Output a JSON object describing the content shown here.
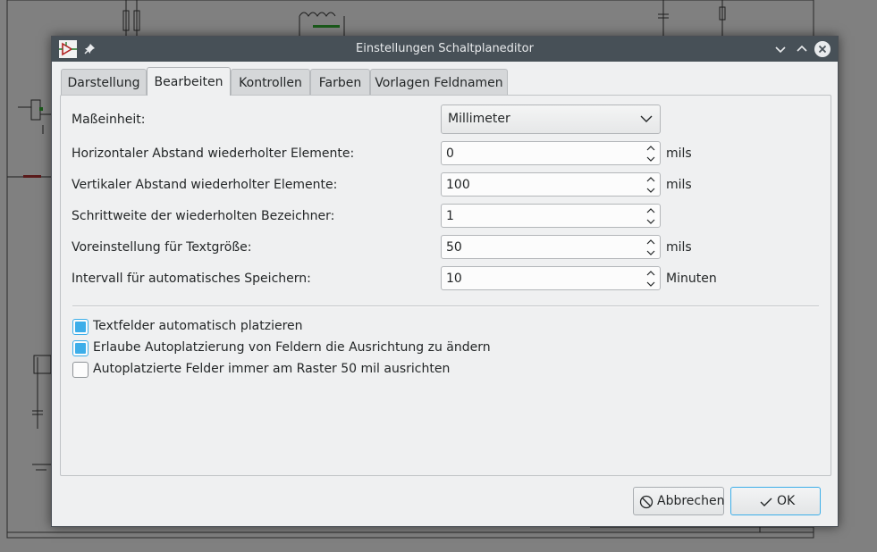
{
  "window": {
    "title": "Einstellungen Schaltplaneditor"
  },
  "tabs": [
    {
      "label": "Darstellung",
      "active": false
    },
    {
      "label": "Bearbeiten",
      "active": true
    },
    {
      "label": "Kontrollen",
      "active": false
    },
    {
      "label": "Farben",
      "active": false
    },
    {
      "label": "Vorlagen Feldnamen",
      "active": false
    }
  ],
  "form": {
    "unit": {
      "label": "Maßeinheit:",
      "value": "Millimeter"
    },
    "h_spacing": {
      "label": "Horizontaler Abstand wiederholter Elemente:",
      "value": "0",
      "unit": "mils"
    },
    "v_spacing": {
      "label": "Vertikaler Abstand wiederholter Elemente:",
      "value": "100",
      "unit": "mils"
    },
    "label_increment": {
      "label": "Schrittweite der wiederholten Bezeichner:",
      "value": "1"
    },
    "text_size": {
      "label": "Voreinstellung für Textgröße:",
      "value": "50",
      "unit": "mils"
    },
    "autosave": {
      "label": "Intervall für automatisches Speichern:",
      "value": "10",
      "unit": "Minuten"
    }
  },
  "checkboxes": [
    {
      "label": "Textfelder automatisch platzieren",
      "checked": true
    },
    {
      "label": "Erlaube Autoplatzierung von Feldern die Ausrichtung zu ändern",
      "checked": true
    },
    {
      "label": "Autoplatzierte Felder immer am Raster 50 mil ausrichten",
      "checked": false
    }
  ],
  "buttons": {
    "cancel": "Abbrechen",
    "ok": "OK"
  },
  "colors": {
    "accent": "#3daee9",
    "titlebar": "#475057",
    "dialog_bg": "#eff0f1"
  },
  "icons": {
    "app": "kicad-eeschema-icon",
    "pin": "pin-icon",
    "minimize": "chevron-down-icon",
    "maximize": "chevron-up-icon",
    "close": "close-icon",
    "cancel": "cancel-circle-icon",
    "ok": "checkmark-icon"
  }
}
